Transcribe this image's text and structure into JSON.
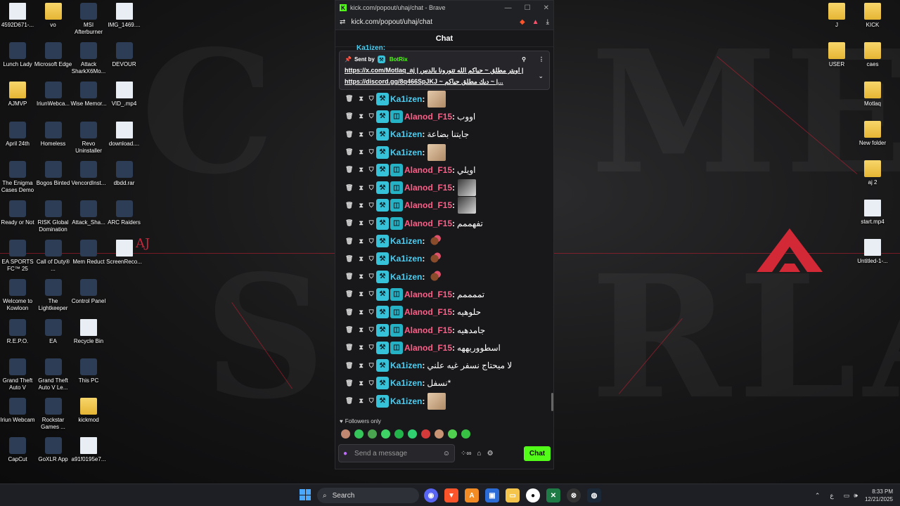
{
  "desktop": {
    "left_icons": [
      {
        "label": "4592D671-...",
        "type": "file",
        "col": 0,
        "row": 0
      },
      {
        "label": "vo",
        "type": "folder",
        "col": 1,
        "row": 0
      },
      {
        "label": "MSI Afterburner",
        "type": "app",
        "col": 2,
        "row": 0
      },
      {
        "label": "IMG_1469....",
        "type": "file",
        "col": 3,
        "row": 0
      },
      {
        "label": "Lunch Lady",
        "type": "app",
        "col": 0,
        "row": 1
      },
      {
        "label": "Microsoft Edge",
        "type": "app",
        "col": 1,
        "row": 1
      },
      {
        "label": "Attack SharkX6Mo...",
        "type": "app",
        "col": 2,
        "row": 1
      },
      {
        "label": "DEVOUR",
        "type": "app",
        "col": 3,
        "row": 1
      },
      {
        "label": "AJMVP",
        "type": "folder",
        "col": 0,
        "row": 2
      },
      {
        "label": "IriunWebca...",
        "type": "app",
        "col": 1,
        "row": 2
      },
      {
        "label": "Wise Memor...",
        "type": "app",
        "col": 2,
        "row": 2
      },
      {
        "label": "VID_.mp4",
        "type": "file",
        "col": 3,
        "row": 2
      },
      {
        "label": "April 24th",
        "type": "app",
        "col": 0,
        "row": 3
      },
      {
        "label": "Homeless",
        "type": "app",
        "col": 1,
        "row": 3
      },
      {
        "label": "Revo Uninstaller",
        "type": "app",
        "col": 2,
        "row": 3
      },
      {
        "label": "download....",
        "type": "file",
        "col": 3,
        "row": 3
      },
      {
        "label": "The Enigma Cases Demo",
        "type": "app",
        "col": 0,
        "row": 4
      },
      {
        "label": "Bogos Binted",
        "type": "app",
        "col": 1,
        "row": 4
      },
      {
        "label": "VencordInst...",
        "type": "app",
        "col": 2,
        "row": 4
      },
      {
        "label": "dbdd.rar",
        "type": "app",
        "col": 3,
        "row": 4
      },
      {
        "label": "Ready or Not",
        "type": "app",
        "col": 0,
        "row": 5
      },
      {
        "label": "RISK Global Domination",
        "type": "app",
        "col": 1,
        "row": 5
      },
      {
        "label": "Attack_Sha...",
        "type": "app",
        "col": 2,
        "row": 5
      },
      {
        "label": "ARC Raiders",
        "type": "app",
        "col": 3,
        "row": 5
      },
      {
        "label": "EA SPORTS FC™ 25",
        "type": "app",
        "col": 0,
        "row": 6
      },
      {
        "label": "Call of Duty® ...",
        "type": "app",
        "col": 1,
        "row": 6
      },
      {
        "label": "Mem Reduct",
        "type": "app",
        "col": 2,
        "row": 6
      },
      {
        "label": "ScreenReco...",
        "type": "file",
        "col": 3,
        "row": 6
      },
      {
        "label": "Welcome to Kowloon",
        "type": "app",
        "col": 0,
        "row": 7
      },
      {
        "label": "The Lightkeeper",
        "type": "app",
        "col": 1,
        "row": 7
      },
      {
        "label": "Control Panel",
        "type": "app",
        "col": 2,
        "row": 7
      },
      {
        "label": "R.E.P.O.",
        "type": "app",
        "col": 0,
        "row": 8
      },
      {
        "label": "EA",
        "type": "app",
        "col": 1,
        "row": 8
      },
      {
        "label": "Recycle Bin",
        "type": "file",
        "col": 2,
        "row": 8
      },
      {
        "label": "Grand Theft Auto V",
        "type": "app",
        "col": 0,
        "row": 9
      },
      {
        "label": "Grand Theft Auto V Le...",
        "type": "app",
        "col": 1,
        "row": 9
      },
      {
        "label": "This PC",
        "type": "app",
        "col": 2,
        "row": 9
      },
      {
        "label": "Iriun Webcam",
        "type": "app",
        "col": 0,
        "row": 10
      },
      {
        "label": "Rockstar Games ...",
        "type": "app",
        "col": 1,
        "row": 10
      },
      {
        "label": "kickmod",
        "type": "folder",
        "col": 2,
        "row": 10
      },
      {
        "label": "CapCut",
        "type": "app",
        "col": 0,
        "row": 11
      },
      {
        "label": "GoXLR App",
        "type": "app",
        "col": 1,
        "row": 11
      },
      {
        "label": "a91f0195e7...",
        "type": "file",
        "col": 2,
        "row": 11
      }
    ],
    "right_icons": [
      {
        "label": "J",
        "type": "folder",
        "col": 0,
        "row": 0
      },
      {
        "label": "KICK",
        "type": "folder",
        "col": 1,
        "row": 0
      },
      {
        "label": "USER",
        "type": "folder",
        "col": 0,
        "row": 1
      },
      {
        "label": "caes",
        "type": "folder",
        "col": 1,
        "row": 1
      },
      {
        "label": "Motlaq",
        "type": "folder",
        "col": 1,
        "row": 2
      },
      {
        "label": "New folder",
        "type": "folder",
        "col": 1,
        "row": 3
      },
      {
        "label": "aj 2",
        "type": "folder",
        "col": 1,
        "row": 4
      },
      {
        "label": "start.mp4",
        "type": "file",
        "col": 1,
        "row": 5
      },
      {
        "label": "Untitled-1-...",
        "type": "file",
        "col": 1,
        "row": 6
      }
    ],
    "aj_logo": "AJ"
  },
  "browser": {
    "tab_title": "kick.com/popout/uhaj/chat - Brave",
    "url": "kick.com/popout/uhaj/chat"
  },
  "chat": {
    "header": "Chat",
    "partial_top": "Ka1izen:",
    "pinned": {
      "sent_by_label": "Sent by",
      "bot_name": "BotRix",
      "line1": "https://x.com/Motlaq_aj | اويتر مطلق ~ حياكم الله تتورونا بالدس |",
      "line2": "https://discord.gg/8q466SpJKJ ~ ديك مطلق حياكم ~ |...",
      "chevron": "⌄"
    },
    "messages": [
      {
        "user": "Ka1izen",
        "kind": "ka",
        "text": "",
        "emote": "photo"
      },
      {
        "user": "Alanod_F15",
        "kind": "al",
        "text": "اووب",
        "emote": ""
      },
      {
        "user": "Ka1izen",
        "kind": "ka",
        "text": "جايتنا بضاعة",
        "emote": ""
      },
      {
        "user": "Ka1izen",
        "kind": "ka",
        "text": "",
        "emote": "photo"
      },
      {
        "user": "Alanod_F15",
        "kind": "al",
        "text": "اويلي",
        "emote": ""
      },
      {
        "user": "Alanod_F15",
        "kind": "al",
        "text": "",
        "emote": "dark"
      },
      {
        "user": "Alanod_F15",
        "kind": "al",
        "text": "",
        "emote": "dark"
      },
      {
        "user": "Alanod_F15",
        "kind": "al",
        "text": "تفهممم",
        "emote": ""
      },
      {
        "user": "Ka1izen",
        "kind": "ka",
        "text": "",
        "emote": "small"
      },
      {
        "user": "Ka1izen",
        "kind": "ka",
        "text": "",
        "emote": "small"
      },
      {
        "user": "Ka1izen",
        "kind": "ka",
        "text": "",
        "emote": "small"
      },
      {
        "user": "Alanod_F15",
        "kind": "al",
        "text": "تممممم",
        "emote": ""
      },
      {
        "user": "Alanod_F15",
        "kind": "al",
        "text": "حلوهيه",
        "emote": ""
      },
      {
        "user": "Alanod_F15",
        "kind": "al",
        "text": "جامدهيه",
        "emote": ""
      },
      {
        "user": "Alanod_F15",
        "kind": "al",
        "text": "اسطووريههه",
        "emote": ""
      },
      {
        "user": "Ka1izen",
        "kind": "ka",
        "text": "لا ميحتاج نسفر غيه علني",
        "emote": ""
      },
      {
        "user": "Ka1izen",
        "kind": "ka",
        "text": "*نسفل",
        "emote": ""
      },
      {
        "user": "Ka1izen",
        "kind": "ka",
        "text": "",
        "emote": "photo"
      }
    ],
    "followers_only": "Followers only",
    "input_placeholder": "Send a message",
    "send_label": "Chat"
  },
  "taskbar": {
    "search_label": "Search",
    "lang": "ع",
    "time": "8:33 PM",
    "date": "12/21/2025"
  }
}
